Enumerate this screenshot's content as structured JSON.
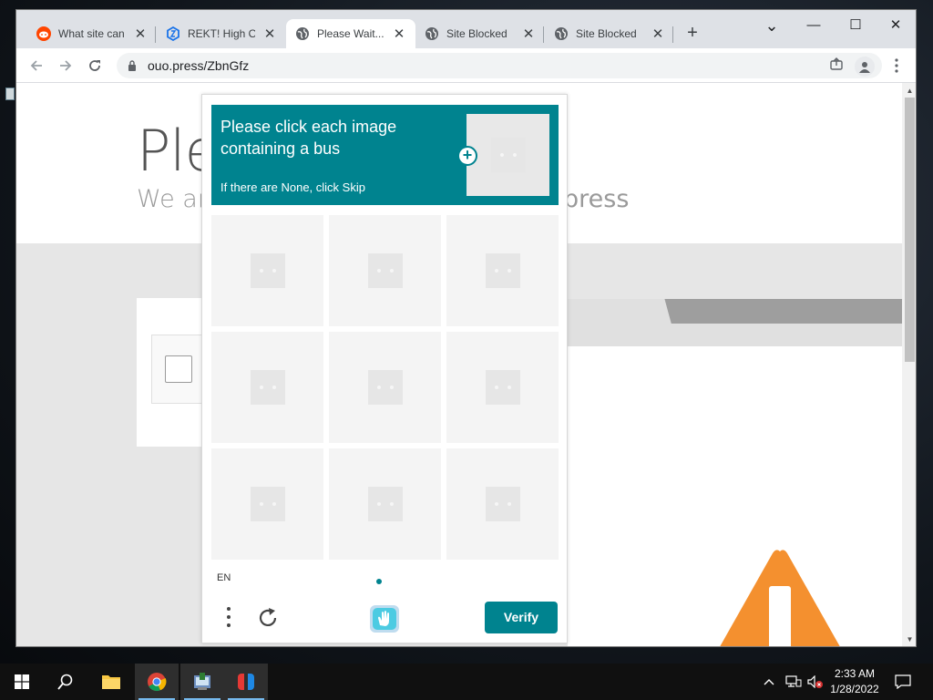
{
  "browser": {
    "tabs": [
      {
        "title": "What site can",
        "icon": "reddit-icon",
        "active": false
      },
      {
        "title": "REKT! High Oc",
        "icon": "hexagon-icon",
        "active": false
      },
      {
        "title": "Please Wait...",
        "icon": "globe-icon",
        "active": true
      },
      {
        "title": "Site Blocked",
        "icon": "globe-icon",
        "active": false
      },
      {
        "title": "Site Blocked",
        "icon": "globe-icon",
        "active": false
      }
    ],
    "new_tab_glyph": "+",
    "tab_close_glyph": "✕",
    "url": "ouo.press/ZbnGfz",
    "window_controls": {
      "minimize": "—",
      "maximize": "☐",
      "close": "✕",
      "tab_search": "⌄"
    }
  },
  "page": {
    "title_fragment": "Ple",
    "subtitle_fragment": "We ar",
    "subtitle_end_fragment": "press"
  },
  "captcha": {
    "prompt": "Please click each image containing a bus",
    "hint": "If there are None, click Skip",
    "language": "EN",
    "verify_label": "Verify",
    "menu_glyph": "⋮",
    "accent_color": "#00838f"
  },
  "taskbar": {
    "time": "2:33 AM",
    "date": "1/28/2022",
    "tray_up": "^"
  },
  "colors": {
    "warning": "#f4902f"
  }
}
